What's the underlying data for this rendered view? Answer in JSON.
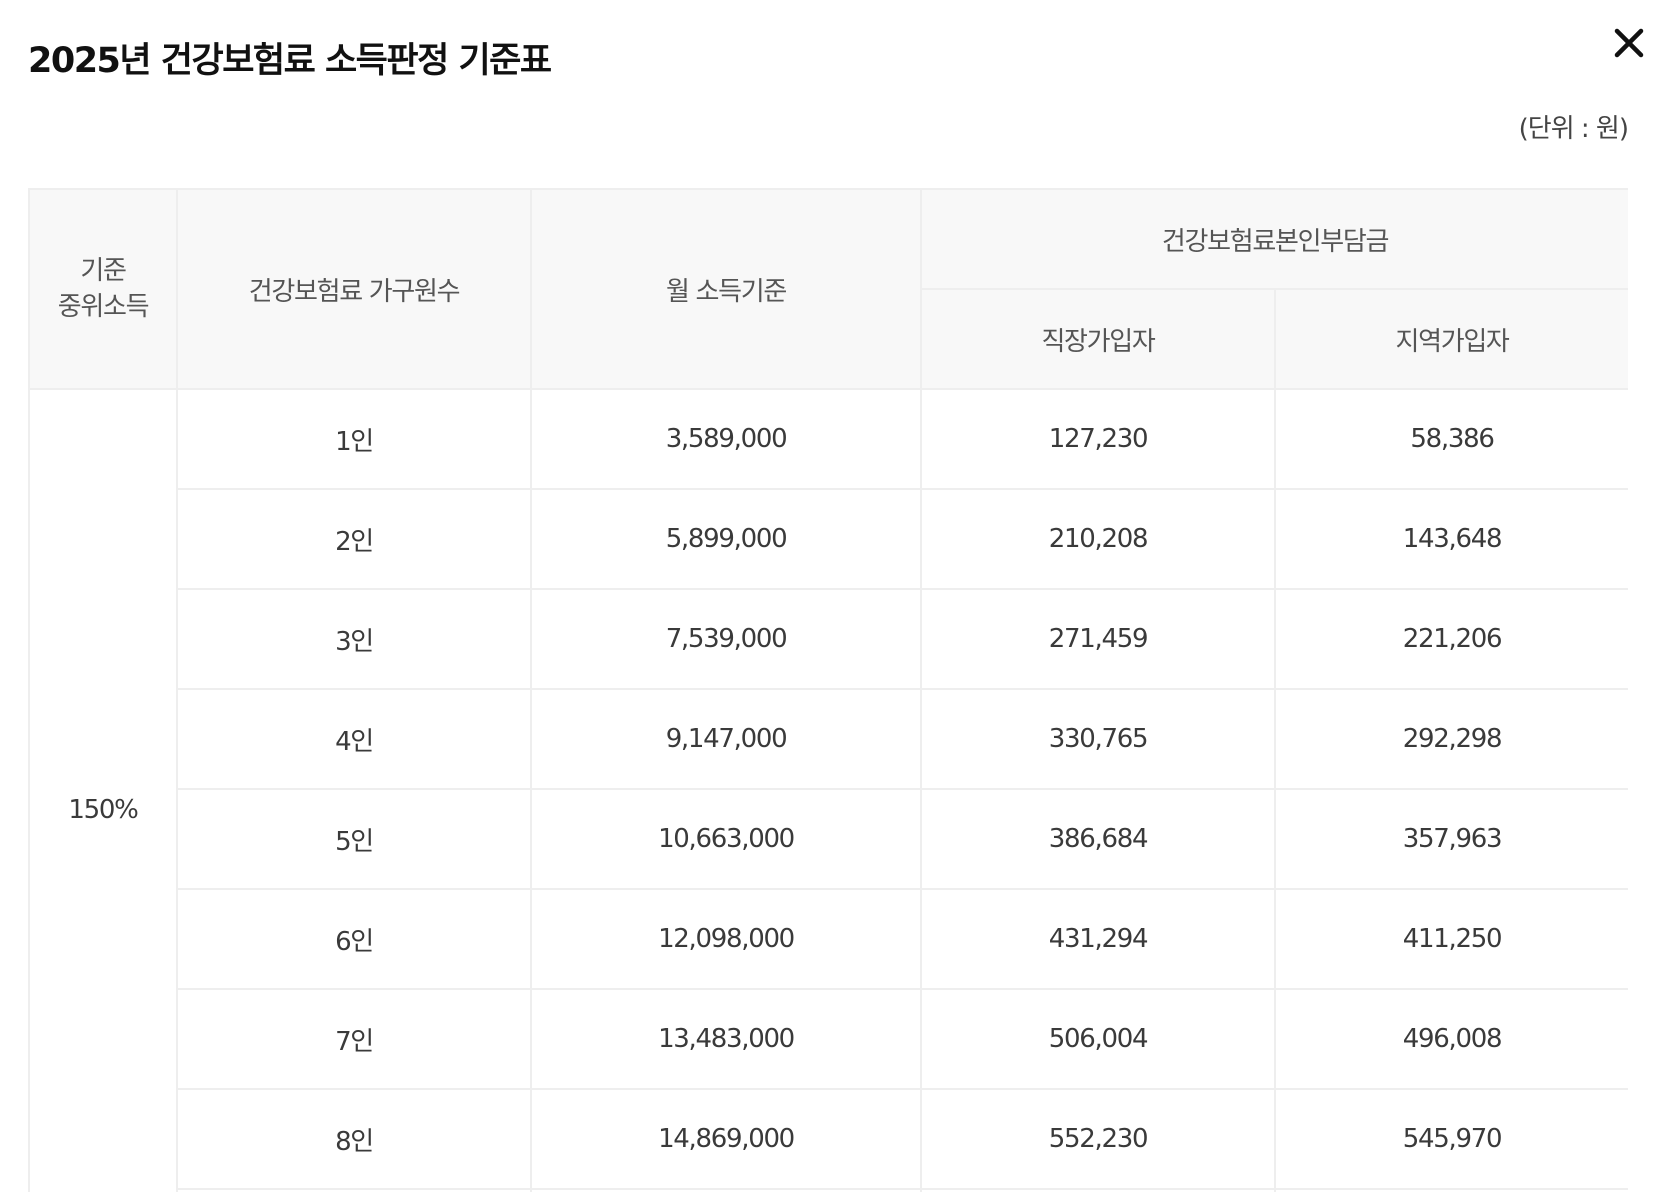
{
  "modal": {
    "title": "2025년 건강보험료 소득판정 기준표",
    "close_icon": "close-icon",
    "unit_note": "(단위 : 원)"
  },
  "table": {
    "headers": {
      "median_line1": "기준",
      "median_line2": "중위소득",
      "household": "건강보험료 가구원수",
      "income": "월 소득기준",
      "contribution_group": "건강보험료본인부담금",
      "employee": "직장가입자",
      "regional": "지역가입자"
    },
    "median_value": "150%",
    "rows": [
      {
        "household": "1인",
        "income": "3,589,000",
        "employee": "127,230",
        "regional": "58,386"
      },
      {
        "household": "2인",
        "income": "5,899,000",
        "employee": "210,208",
        "regional": "143,648"
      },
      {
        "household": "3인",
        "income": "7,539,000",
        "employee": "271,459",
        "regional": "221,206"
      },
      {
        "household": "4인",
        "income": "9,147,000",
        "employee": "330,765",
        "regional": "292,298"
      },
      {
        "household": "5인",
        "income": "10,663,000",
        "employee": "386,684",
        "regional": "357,963"
      },
      {
        "household": "6인",
        "income": "12,098,000",
        "employee": "431,294",
        "regional": "411,250"
      },
      {
        "household": "7인",
        "income": "13,483,000",
        "employee": "506,004",
        "regional": "496,008"
      },
      {
        "household": "8인",
        "income": "14,869,000",
        "employee": "552,230",
        "regional": "545,970"
      }
    ]
  }
}
